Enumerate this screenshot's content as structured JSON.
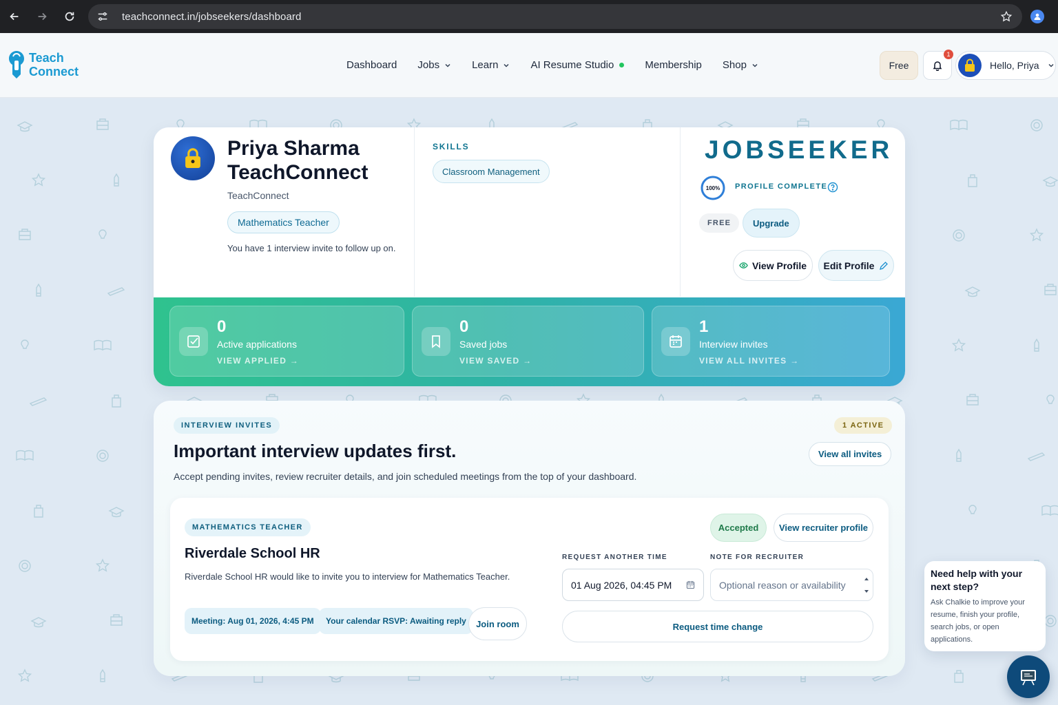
{
  "browser": {
    "url": "teachconnect.in/jobseekers/dashboard",
    "icons": [
      "back-icon",
      "forward-icon",
      "reload-icon",
      "site-info-icon",
      "bookmark-star-icon",
      "profile-icon"
    ]
  },
  "header": {
    "logo_line1": "Teach",
    "logo_line2": "Connect",
    "nav": [
      {
        "label": "Dashboard",
        "dropdown": false
      },
      {
        "label": "Jobs",
        "dropdown": true
      },
      {
        "label": "Learn",
        "dropdown": true
      },
      {
        "label": "AI Resume Studio",
        "dropdown": false,
        "status_dot": true
      },
      {
        "label": "Membership",
        "dropdown": false
      },
      {
        "label": "Shop",
        "dropdown": true
      }
    ],
    "plan_button": "Free",
    "notification_count": "1",
    "greeting": "Hello, Priya"
  },
  "profile": {
    "name_line1": "Priya Sharma",
    "name_line2": "TeachConnect",
    "organization": "TeachConnect",
    "role": "Mathematics Teacher",
    "invite_note": "You have 1 interview invite to follow up on.",
    "skills_heading": "SKILLS",
    "skills": [
      "Classroom Management"
    ],
    "account_type": "JOBSEEKER",
    "completion": 100,
    "completion_label": "100%",
    "completion_text": "PROFILE COMPLETE",
    "plan_tag": "FREE",
    "upgrade": "Upgrade",
    "view_profile": "View Profile",
    "edit_profile": "Edit Profile"
  },
  "stats": [
    {
      "value": "0",
      "label": "Active applications",
      "link": "VIEW APPLIED →",
      "icon": "checkbox-icon"
    },
    {
      "value": "0",
      "label": "Saved jobs",
      "link": "VIEW SAVED →",
      "icon": "bookmark-icon"
    },
    {
      "value": "1",
      "label": "Interview invites",
      "link": "VIEW ALL INVITES →",
      "icon": "calendar-icon"
    }
  ],
  "invites": {
    "tag": "INTERVIEW INVITES",
    "active_count": "1 ACTIVE",
    "heading": "Important interview updates first.",
    "subtext": "Accept pending invites, review recruiter details, and join scheduled meetings from the top of your dashboard.",
    "view_all": "View all invites",
    "item": {
      "role_tag": "MATHEMATICS TEACHER",
      "school": "Riverdale School HR",
      "description": "Riverdale School HR would like to invite you to interview for Mathematics Teacher.",
      "meeting": "Meeting: Aug 01, 2026, 4:45 PM",
      "rsvp": "Your calendar RSVP: Awaiting reply",
      "join_room": "Join room",
      "status": "Accepted",
      "view_recruiter": "View recruiter profile",
      "request_time_label": "REQUEST ANOTHER TIME",
      "request_time_value": "01 Aug 2026, 04:45 PM",
      "note_label": "NOTE FOR RECRUITER",
      "note_placeholder": "Optional reason or availability",
      "request_button": "Request time change"
    }
  },
  "chat": {
    "title": "Need help with your next step?",
    "message": "Ask Chalkie to improve your resume, finish your profile, search jobs, or open applications."
  },
  "colors": {
    "brand": "#1b9ad2",
    "accent_green": "#2fc28e",
    "accent_blue": "#3aa8d4",
    "badge_red": "#e04e3d"
  }
}
